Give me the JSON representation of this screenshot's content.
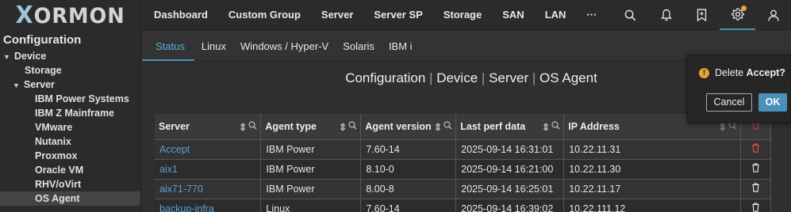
{
  "logo": {
    "x": "X",
    "rest": "ORMON"
  },
  "sidebar": {
    "title": "Configuration",
    "items": [
      {
        "label": "Device"
      },
      {
        "label": "Storage"
      },
      {
        "label": "Server"
      },
      {
        "label": "IBM Power Systems"
      },
      {
        "label": "IBM Z Mainframe"
      },
      {
        "label": "VMware"
      },
      {
        "label": "Nutanix"
      },
      {
        "label": "Proxmox"
      },
      {
        "label": "Oracle VM"
      },
      {
        "label": "RHV/oVirt"
      },
      {
        "label": "OS Agent"
      }
    ]
  },
  "nav": {
    "items": [
      "Dashboard",
      "Custom Group",
      "Server",
      "Server SP",
      "Storage",
      "SAN",
      "LAN",
      "···"
    ],
    "icons": [
      "search-icon",
      "bell-icon",
      "bookmark-icon",
      "gear-icon",
      "user-icon"
    ]
  },
  "tabs": [
    "Status",
    "Linux",
    "Windows / Hyper-V",
    "Solaris",
    "IBM i"
  ],
  "page_title": {
    "parts": [
      "Configuration",
      "Device",
      "Server",
      "OS Agent"
    ],
    "separator": "|"
  },
  "table": {
    "columns": [
      "Server",
      "Agent type",
      "Agent version",
      "Last perf data",
      "IP Address"
    ],
    "rows": [
      {
        "server": "Accept",
        "type": "IBM Power",
        "version": "7.60-14",
        "last": "2025-09-14 16:31:01",
        "ip": "10.22.11.31"
      },
      {
        "server": "aix1",
        "type": "IBM Power",
        "version": "8.10-0",
        "last": "2025-09-14 16:21:00",
        "ip": "10.22.11.30"
      },
      {
        "server": "aix71-770",
        "type": "IBM Power",
        "version": "8.00-8",
        "last": "2025-09-14 16:25:01",
        "ip": "10.22.11.17"
      },
      {
        "server": "backup-infra",
        "type": "Linux",
        "version": "7.60-14",
        "last": "2025-09-14 16:39:02",
        "ip": "10.22.111.12"
      }
    ]
  },
  "popup": {
    "message_prefix": "Delete",
    "message_target": "Accept?",
    "cancel_label": "Cancel",
    "ok_label": "OK"
  },
  "colors": {
    "accent": "#4a90b8",
    "link": "#5aa0cc",
    "warning": "#e8a33a",
    "delete_active": "#d9534f"
  }
}
